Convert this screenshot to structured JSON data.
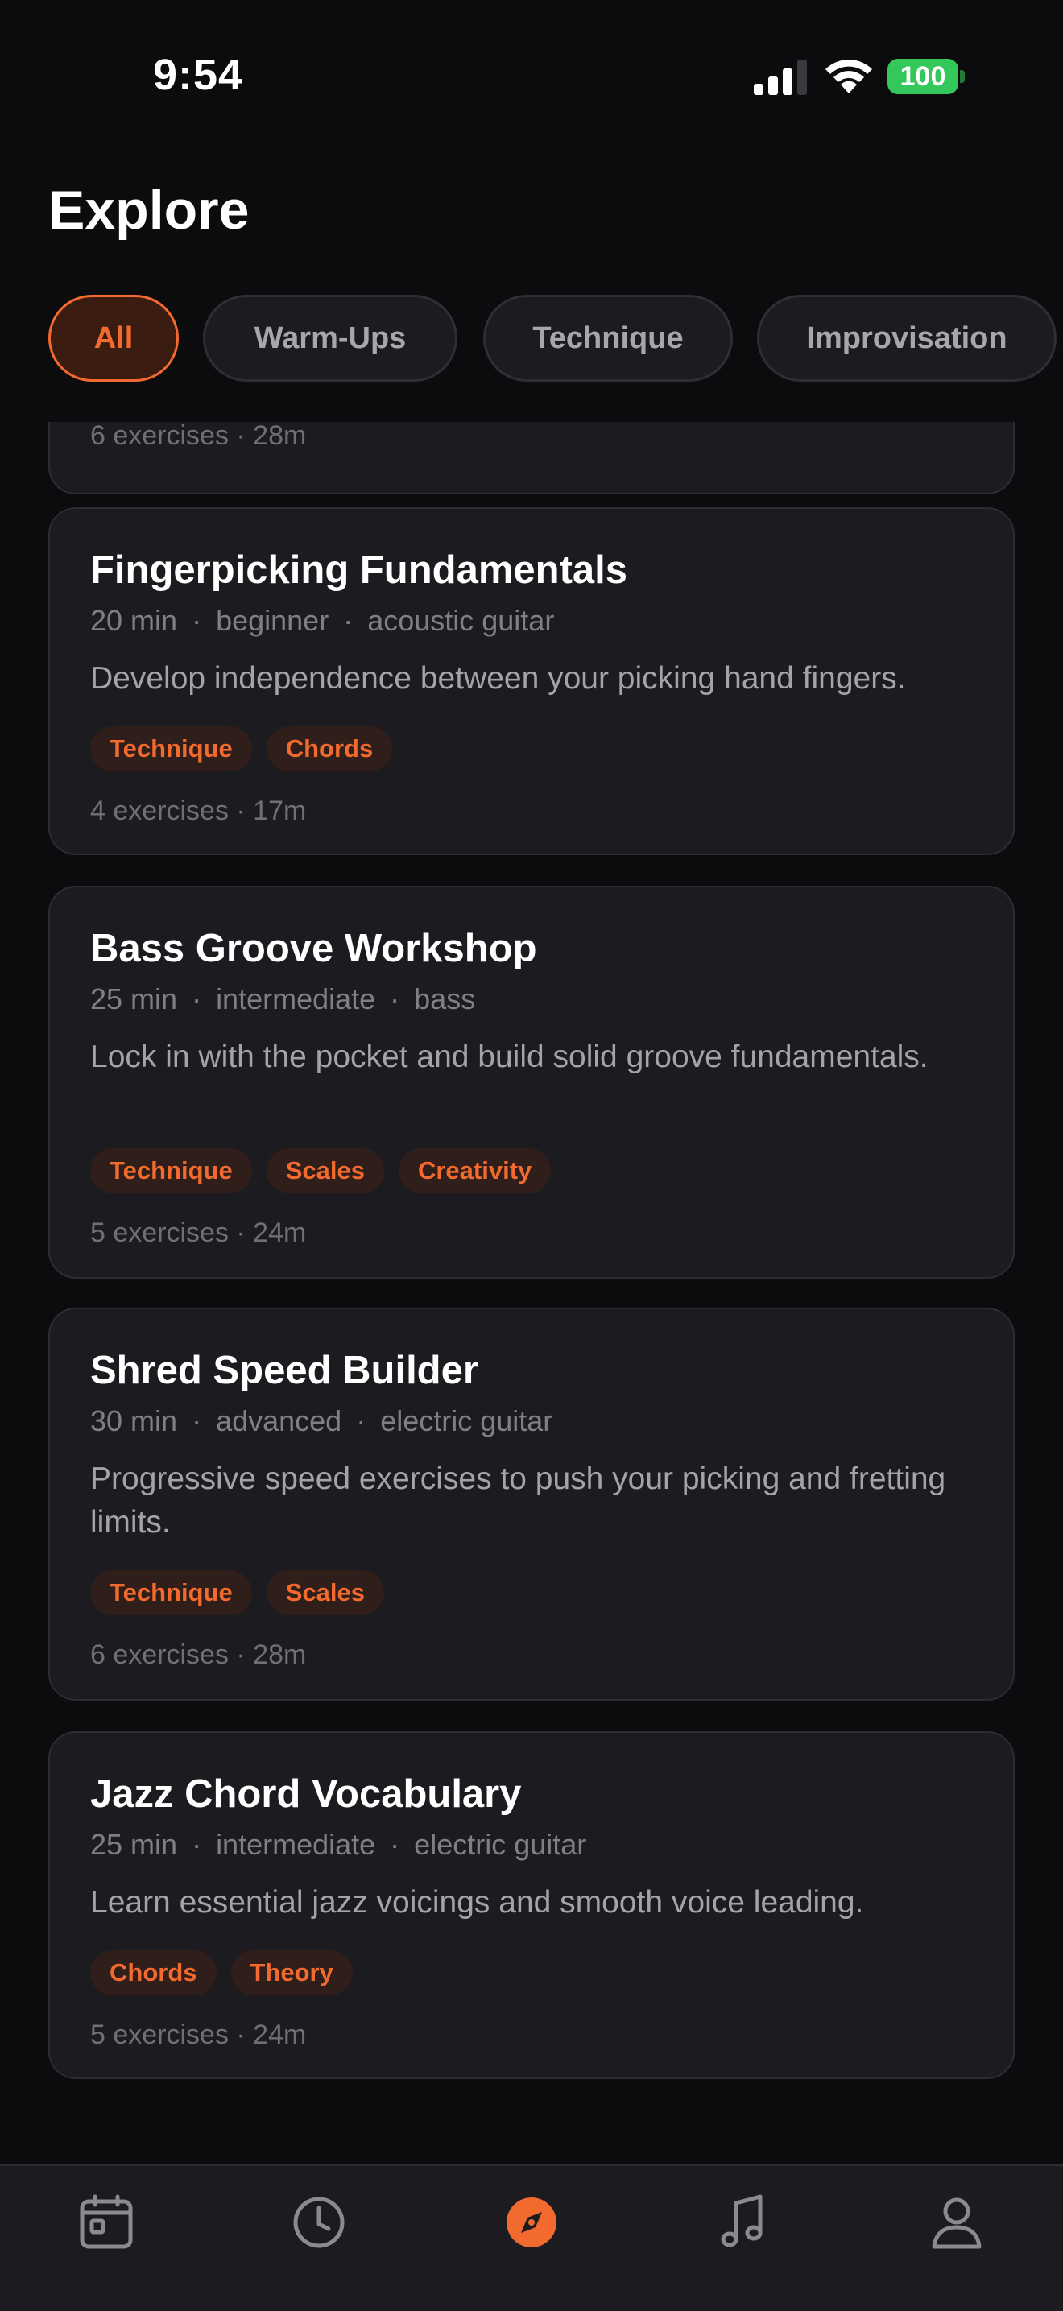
{
  "status_bar": {
    "time": "9:54",
    "battery": "100"
  },
  "header": {
    "title": "Explore"
  },
  "filters": [
    {
      "label": "All",
      "active": true
    },
    {
      "label": "Warm-Ups",
      "active": false
    },
    {
      "label": "Technique",
      "active": false
    },
    {
      "label": "Improvisation",
      "active": false
    }
  ],
  "partial_card": {
    "footer": "6 exercises · 28m"
  },
  "cards": [
    {
      "title": "Fingerpicking Fundamentals",
      "duration": "20 min",
      "level": "beginner",
      "instrument": "acoustic guitar",
      "description": "Develop independence between your picking hand fingers.",
      "tags": [
        "Technique",
        "Chords"
      ],
      "footer": "4 exercises · 17m"
    },
    {
      "title": "Bass Groove Workshop",
      "duration": "25 min",
      "level": "intermediate",
      "instrument": "bass",
      "description": "Lock in with the pocket and build solid groove fundamentals.",
      "tags": [
        "Technique",
        "Scales",
        "Creativity"
      ],
      "footer": "5 exercises · 24m"
    },
    {
      "title": "Shred Speed Builder",
      "duration": "30 min",
      "level": "advanced",
      "instrument": "electric guitar",
      "description": "Progressive speed exercises to push your picking and fretting limits.",
      "tags": [
        "Technique",
        "Scales"
      ],
      "footer": "6 exercises · 28m"
    },
    {
      "title": "Jazz Chord Vocabulary",
      "duration": "25 min",
      "level": "intermediate",
      "instrument": "electric guitar",
      "description": "Learn essential jazz voicings and smooth voice leading.",
      "tags": [
        "Chords",
        "Theory"
      ],
      "footer": "5 exercises · 24m"
    }
  ],
  "meta_separator": "·",
  "tab_bar": {
    "tabs": [
      {
        "icon": "calendar-icon",
        "active": false
      },
      {
        "icon": "clock-icon",
        "active": false
      },
      {
        "icon": "compass-icon",
        "active": true
      },
      {
        "icon": "music-note-icon",
        "active": false
      },
      {
        "icon": "person-icon",
        "active": false
      }
    ]
  },
  "colors": {
    "background": "#0c0c0e",
    "card": "#1c1c20",
    "accent": "#f26a2e",
    "battery": "#34c759"
  }
}
